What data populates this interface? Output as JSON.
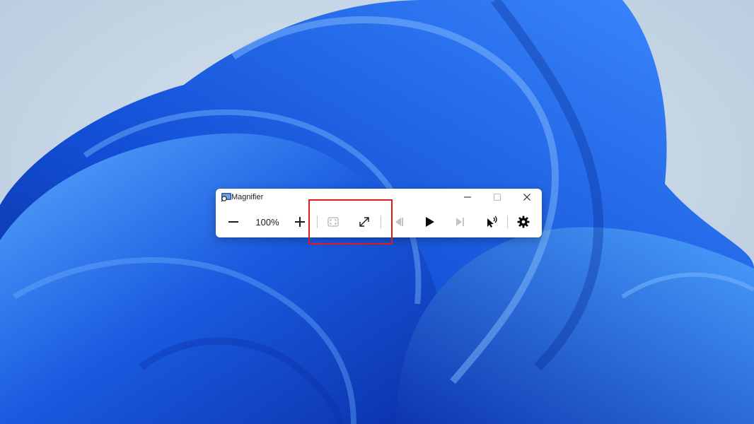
{
  "window": {
    "title": "Magnifier",
    "icon": "magnifier-app-icon",
    "caption_buttons": [
      "minimize-icon",
      "maximize-icon",
      "close-icon"
    ]
  },
  "toolbar": {
    "zoom_out_icon": "minus-icon",
    "zoom_level": "100%",
    "zoom_in_icon": "plus-icon",
    "buttons": [
      {
        "name": "reset-view",
        "icon": "fit-screen-icon",
        "enabled": false
      },
      {
        "name": "change-view",
        "icon": "expand-arrows-icon",
        "enabled": true
      },
      {
        "name": "previous",
        "icon": "previous-icon",
        "enabled": false
      },
      {
        "name": "play",
        "icon": "play-icon",
        "enabled": true
      },
      {
        "name": "next",
        "icon": "next-icon",
        "enabled": false
      },
      {
        "name": "read-from-here",
        "icon": "pointer-speak-icon",
        "enabled": true
      },
      {
        "name": "settings",
        "icon": "gear-icon",
        "enabled": true
      }
    ]
  },
  "annotation": {
    "highlight_color": "#e0191b"
  },
  "colors": {
    "wallpaper_bg": "#c7d6e6",
    "wallpaper_bloom": "#1a5be0"
  }
}
